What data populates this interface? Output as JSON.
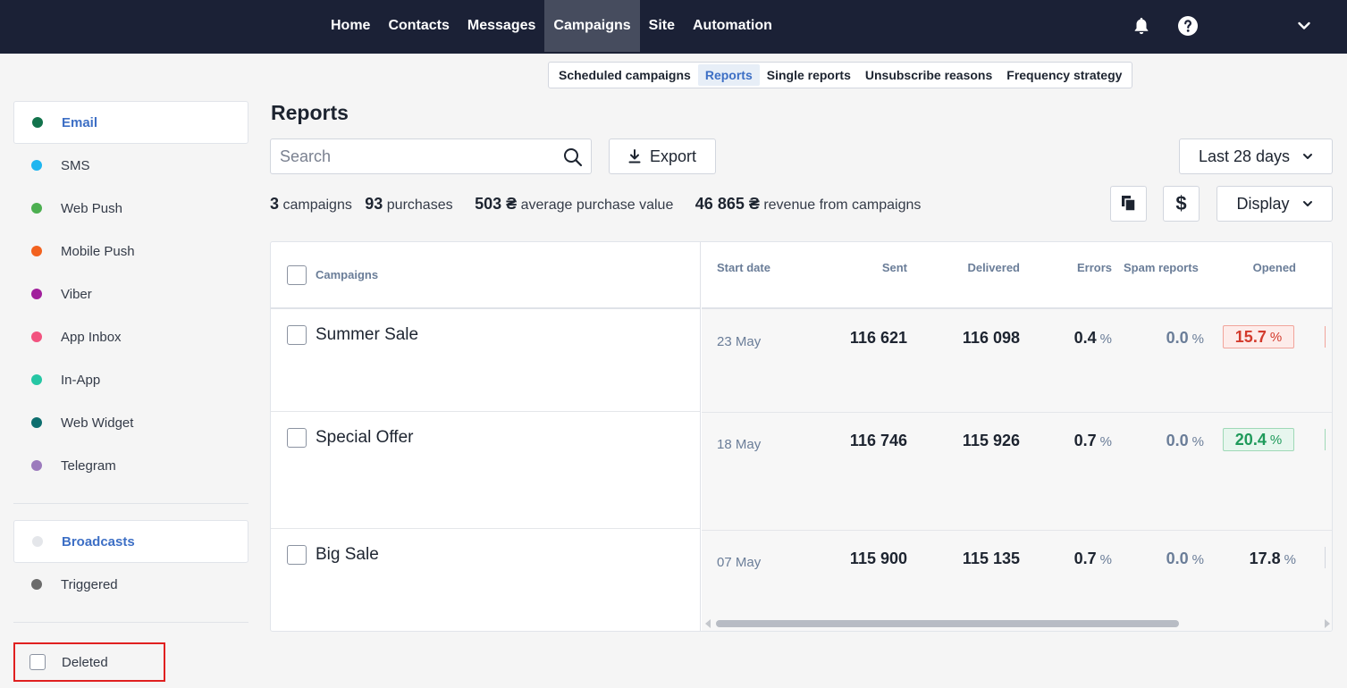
{
  "topnav": {
    "items": [
      {
        "label": "Home",
        "active": false
      },
      {
        "label": "Contacts",
        "active": false
      },
      {
        "label": "Messages",
        "active": false
      },
      {
        "label": "Campaigns",
        "active": true
      },
      {
        "label": "Site",
        "active": false
      },
      {
        "label": "Automation",
        "active": false
      }
    ],
    "icons": [
      "bell-icon",
      "help-icon",
      "chevron-down-icon"
    ]
  },
  "subtabs": [
    {
      "label": "Scheduled campaigns",
      "active": false
    },
    {
      "label": "Reports",
      "active": true
    },
    {
      "label": "Single reports",
      "active": false
    },
    {
      "label": "Unsubscribe reasons",
      "active": false
    },
    {
      "label": "Frequency strategy",
      "active": false
    }
  ],
  "sidebar": {
    "channels": [
      {
        "label": "Email",
        "color": "#12734c",
        "active": true
      },
      {
        "label": "SMS",
        "color": "#1fb6f0",
        "active": false
      },
      {
        "label": "Web Push",
        "color": "#4caf50",
        "active": false
      },
      {
        "label": "Mobile Push",
        "color": "#f2621f",
        "active": false
      },
      {
        "label": "Viber",
        "color": "#a11f9c",
        "active": false
      },
      {
        "label": "App Inbox",
        "color": "#f2537f",
        "active": false
      },
      {
        "label": "In-App",
        "color": "#26c6a4",
        "active": false
      },
      {
        "label": "Web Widget",
        "color": "#0d6e6e",
        "active": false
      },
      {
        "label": "Telegram",
        "color": "#9c7bbd",
        "active": false
      }
    ],
    "types": [
      {
        "label": "Broadcasts",
        "color": "#e4e6ea",
        "active": true
      },
      {
        "label": "Triggered",
        "color": "#6b6b6b",
        "active": false
      }
    ],
    "deleted_label": "Deleted"
  },
  "main": {
    "title": "Reports",
    "search_placeholder": "Search",
    "export_label": "Export",
    "period_label": "Last 28 days",
    "display_label": "Display",
    "currency_symbol": "$",
    "summary": {
      "campaigns_count": "3",
      "campaigns_label": "campaigns",
      "purchases_count": "93",
      "purchases_label": "purchases",
      "avg_value": "503 ₴",
      "avg_label": "average purchase value",
      "revenue": "46 865 ₴",
      "revenue_label": "revenue from campaigns"
    }
  },
  "table": {
    "columns": {
      "campaigns": "Campaigns",
      "start_date": "Start date",
      "sent": "Sent",
      "delivered": "Delivered",
      "errors": "Errors",
      "spam": "Spam reports",
      "opened": "Opened"
    },
    "pct_sign": "%",
    "rows": [
      {
        "name": "Summer Sale",
        "start_date": "23 May",
        "sent": "116 621",
        "delivered": "116 098",
        "errors": "0.4",
        "spam": "0.0",
        "opened": "15.7",
        "opened_status": "red"
      },
      {
        "name": "Special Offer",
        "start_date": "18 May",
        "sent": "116 746",
        "delivered": "115 926",
        "errors": "0.7",
        "spam": "0.0",
        "opened": "20.4",
        "opened_status": "green"
      },
      {
        "name": "Big Sale",
        "start_date": "07 May",
        "sent": "115 900",
        "delivered": "115 135",
        "errors": "0.7",
        "spam": "0.0",
        "opened": "17.8",
        "opened_status": "neutral"
      }
    ]
  }
}
